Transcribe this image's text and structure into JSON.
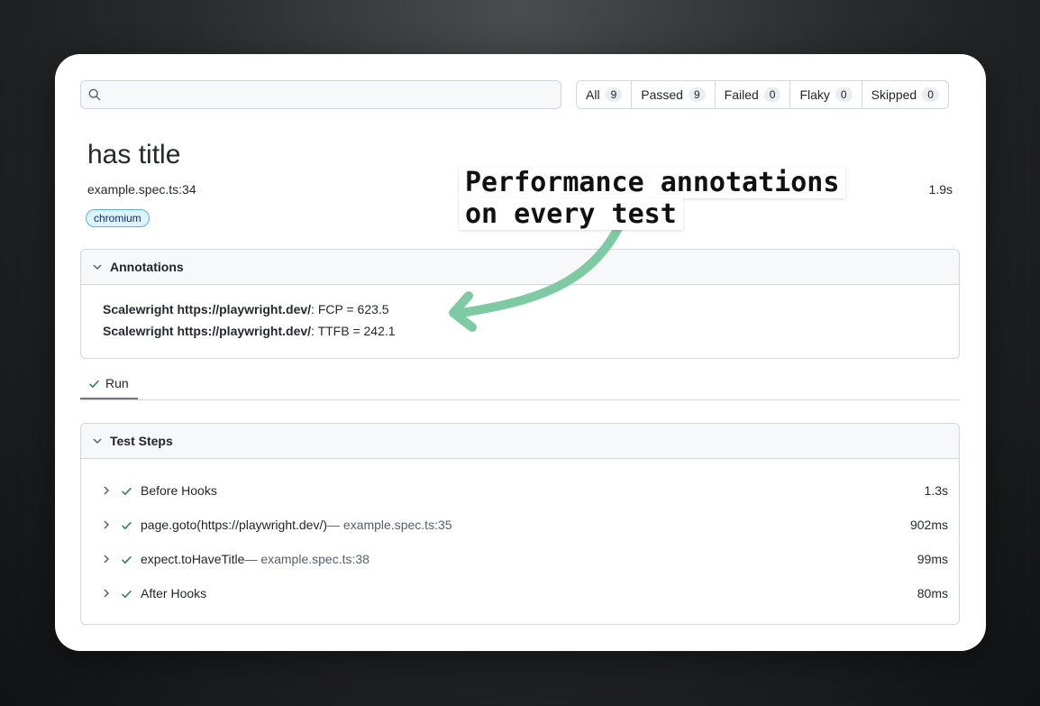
{
  "search": {
    "value": "",
    "placeholder": ""
  },
  "filters": [
    {
      "label": "All",
      "count": "9"
    },
    {
      "label": "Passed",
      "count": "9"
    },
    {
      "label": "Failed",
      "count": "0"
    },
    {
      "label": "Flaky",
      "count": "0"
    },
    {
      "label": "Skipped",
      "count": "0"
    }
  ],
  "test": {
    "title": "has title",
    "location": "example.spec.ts:34",
    "duration": "1.9s",
    "project_tag": "chromium"
  },
  "annotations": {
    "header": "Annotations",
    "items": [
      {
        "type": "Scalewright https://playwright.dev/",
        "description": ": FCP = 623.5"
      },
      {
        "type": "Scalewright https://playwright.dev/",
        "description": ": TTFB = 242.1"
      }
    ]
  },
  "run_tab": {
    "label": "Run"
  },
  "steps": {
    "header": "Test Steps",
    "items": [
      {
        "title": "Before Hooks",
        "location": "",
        "duration": "1.3s"
      },
      {
        "title": "page.goto(https://playwright.dev/)",
        "location": " — example.spec.ts:35",
        "duration": "902ms"
      },
      {
        "title": "expect.toHaveTitle",
        "location": " — example.spec.ts:38",
        "duration": "99ms"
      },
      {
        "title": "After Hooks",
        "location": "",
        "duration": "80ms"
      }
    ]
  },
  "callout": {
    "line1": "Performance annotations",
    "line2": "on every test"
  },
  "colors": {
    "arrow": "#7ecba3",
    "check": "#1a7f37",
    "tag_bg": "#ddf4ff",
    "tag_border": "#54aeff"
  }
}
